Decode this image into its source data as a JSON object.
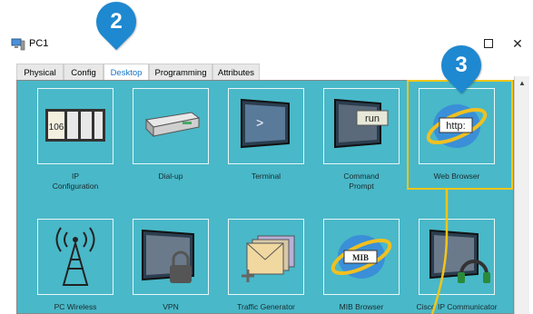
{
  "window": {
    "title": "PC1",
    "maximize_label": "□",
    "close_label": "X"
  },
  "tabs": [
    {
      "label": "Physical",
      "active": false
    },
    {
      "label": "Config",
      "active": false
    },
    {
      "label": "Desktop",
      "active": true
    },
    {
      "label": "Programming",
      "active": false
    },
    {
      "label": "Attributes",
      "active": false
    }
  ],
  "apps": [
    {
      "label": "IP\nConfiguration",
      "icon": "ip-config-icon"
    },
    {
      "label": "Dial-up",
      "icon": "modem-icon"
    },
    {
      "label": "Terminal",
      "icon": "terminal-icon"
    },
    {
      "label": "Command\nPrompt",
      "icon": "command-prompt-icon"
    },
    {
      "label": "Web Browser",
      "icon": "web-browser-icon"
    },
    {
      "label": "PC Wireless",
      "icon": "wireless-antenna-icon"
    },
    {
      "label": "VPN",
      "icon": "vpn-lock-icon"
    },
    {
      "label": "Traffic Generator",
      "icon": "traffic-generator-icon"
    },
    {
      "label": "MIB Browser",
      "icon": "mib-browser-icon"
    },
    {
      "label": "Cisco IP Communicator",
      "icon": "ip-communicator-icon"
    }
  ],
  "icon_text": {
    "ip": "106",
    "terminal": ">",
    "command": "run",
    "browser": "http:",
    "mib": "MIB"
  },
  "callouts": [
    {
      "number": "2",
      "color": "#1e88d0"
    },
    {
      "number": "3",
      "color": "#1e88d0"
    }
  ],
  "highlight_color": "#f5c518"
}
